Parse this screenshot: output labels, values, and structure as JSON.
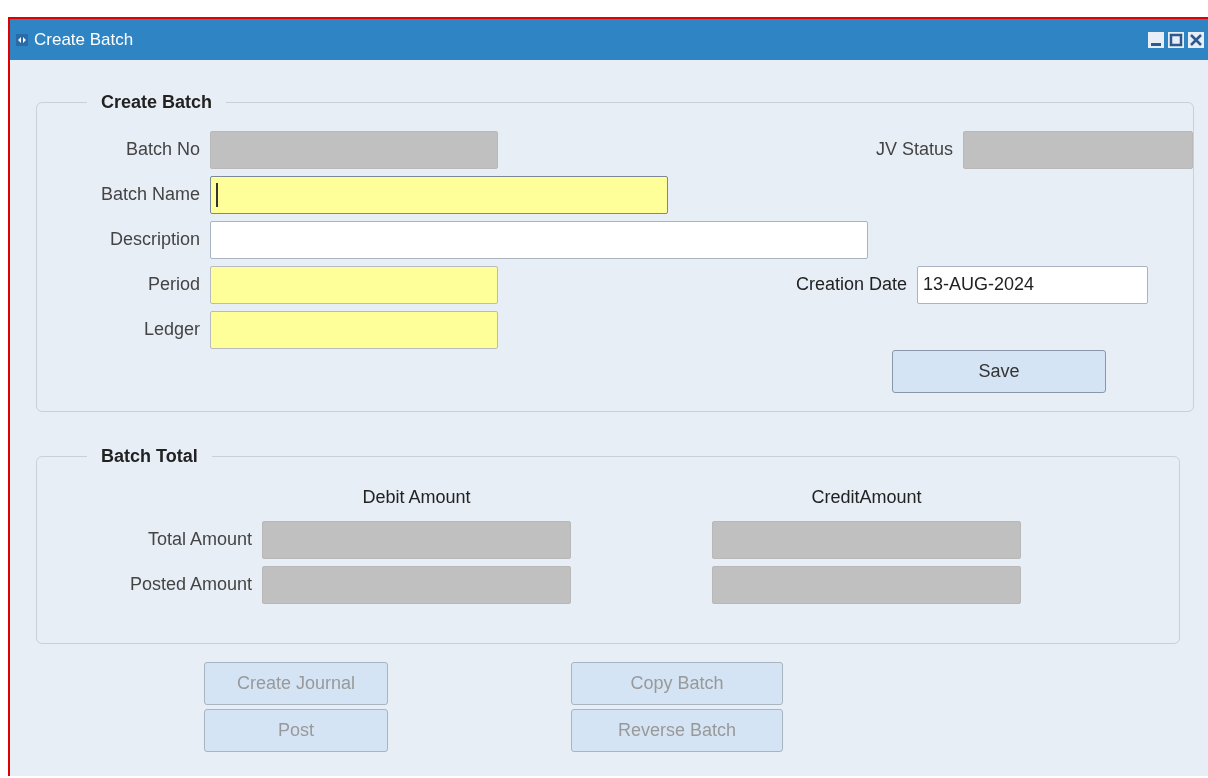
{
  "window": {
    "title": "Create Batch"
  },
  "batch_group": {
    "title": "Create Batch",
    "fields": [
      {
        "label": "Batch No",
        "kind": "readonly",
        "focused": false
      },
      {
        "label": "JV Status",
        "kind": "readonly",
        "focused": false
      },
      {
        "label": "Batch Name",
        "kind": "required",
        "focused": true
      },
      {
        "label": "Description",
        "kind": "plain",
        "focused": false
      },
      {
        "label": "Period",
        "kind": "required",
        "focused": false
      },
      {
        "label": "Creation Date",
        "kind": "plain",
        "focused": false,
        "value": "13-AUG-2024"
      },
      {
        "label": "Ledger",
        "kind": "required",
        "focused": false
      }
    ],
    "save_button": {
      "label": "Save",
      "disabled": false
    }
  },
  "total_group": {
    "title": "Batch Total",
    "columns": [
      "Debit Amount",
      "CreditAmount"
    ],
    "rows": [
      {
        "label": "Total Amount",
        "kind": "readonly"
      },
      {
        "label": "Posted Amount",
        "kind": "readonly"
      }
    ]
  },
  "buttons": [
    {
      "label": "Create Journal",
      "disabled": true
    },
    {
      "label": "Copy Batch",
      "disabled": true
    },
    {
      "label": "Post",
      "disabled": true
    },
    {
      "label": "Reverse Batch",
      "disabled": true
    }
  ]
}
